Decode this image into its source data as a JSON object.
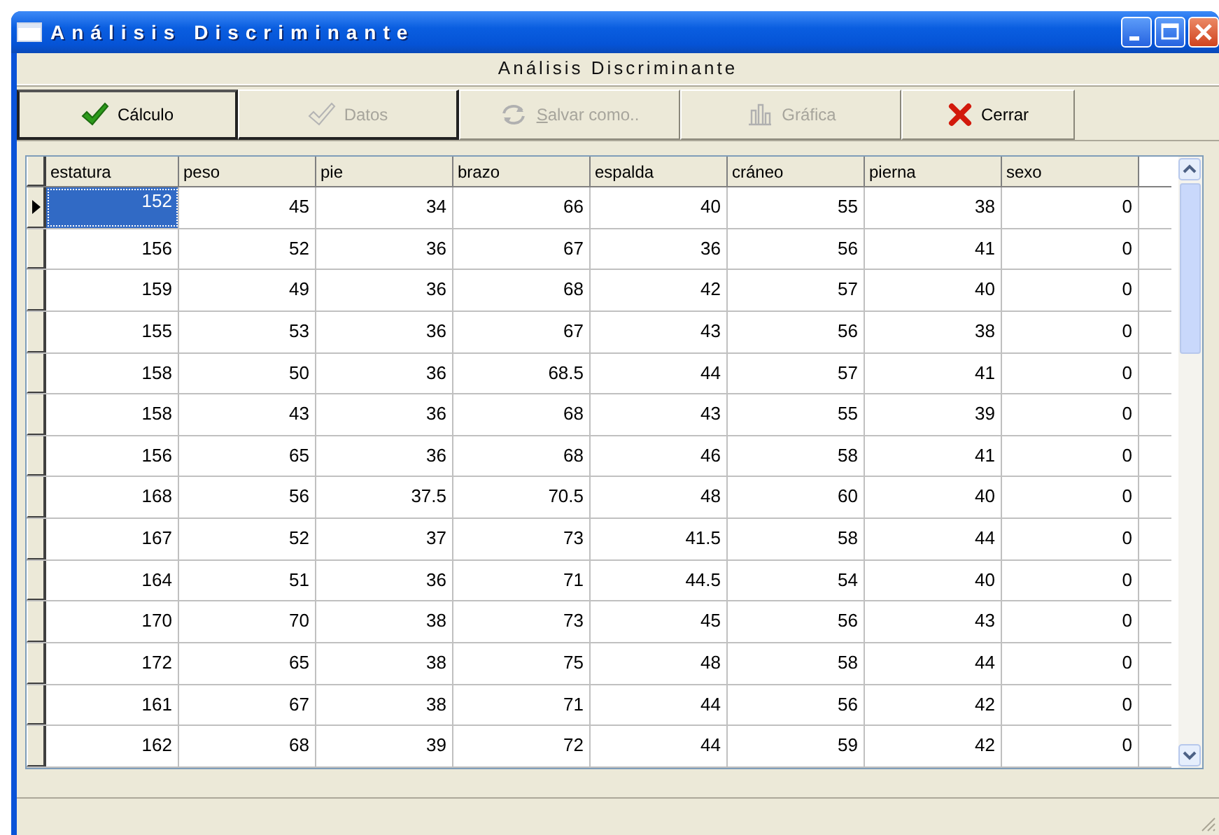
{
  "window": {
    "title": "Análisis Discriminante"
  },
  "header": "Análisis Discriminante",
  "toolbar": [
    {
      "label": "Cálculo",
      "kind": "check",
      "disabled": false,
      "underline": false
    },
    {
      "label": "Datos",
      "kind": "check",
      "disabled": true,
      "underline": false
    },
    {
      "label": "Salvar como..",
      "kind": "refresh",
      "disabled": true,
      "underline": true
    },
    {
      "label": "Gráfica",
      "kind": "chart",
      "disabled": true,
      "underline": false
    },
    {
      "label": "Cerrar",
      "kind": "cross",
      "disabled": false,
      "underline": false
    }
  ],
  "table": {
    "columns": [
      "estatura",
      "peso",
      "pie",
      "brazo",
      "espalda",
      "cráneo",
      "pierna",
      "sexo"
    ],
    "rows": [
      {
        "selected": true,
        "cells": [
          "152",
          "45",
          "34",
          "66",
          "40",
          "55",
          "38",
          "0"
        ]
      },
      {
        "selected": false,
        "cells": [
          "156",
          "52",
          "36",
          "67",
          "36",
          "56",
          "41",
          "0"
        ]
      },
      {
        "selected": false,
        "cells": [
          "159",
          "49",
          "36",
          "68",
          "42",
          "57",
          "40",
          "0"
        ]
      },
      {
        "selected": false,
        "cells": [
          "155",
          "53",
          "36",
          "67",
          "43",
          "56",
          "38",
          "0"
        ]
      },
      {
        "selected": false,
        "cells": [
          "158",
          "50",
          "36",
          "68.5",
          "44",
          "57",
          "41",
          "0"
        ]
      },
      {
        "selected": false,
        "cells": [
          "158",
          "43",
          "36",
          "68",
          "43",
          "55",
          "39",
          "0"
        ]
      },
      {
        "selected": false,
        "cells": [
          "156",
          "65",
          "36",
          "68",
          "46",
          "58",
          "41",
          "0"
        ]
      },
      {
        "selected": false,
        "cells": [
          "168",
          "56",
          "37.5",
          "70.5",
          "48",
          "60",
          "40",
          "0"
        ]
      },
      {
        "selected": false,
        "cells": [
          "167",
          "52",
          "37",
          "73",
          "41.5",
          "58",
          "44",
          "0"
        ]
      },
      {
        "selected": false,
        "cells": [
          "164",
          "51",
          "36",
          "71",
          "44.5",
          "54",
          "40",
          "0"
        ]
      },
      {
        "selected": false,
        "cells": [
          "170",
          "70",
          "38",
          "73",
          "45",
          "56",
          "43",
          "0"
        ]
      },
      {
        "selected": false,
        "cells": [
          "172",
          "65",
          "38",
          "75",
          "48",
          "58",
          "44",
          "0"
        ]
      },
      {
        "selected": false,
        "cells": [
          "161",
          "67",
          "38",
          "71",
          "44",
          "56",
          "42",
          "0"
        ]
      },
      {
        "selected": false,
        "cells": [
          "162",
          "68",
          "39",
          "72",
          "44",
          "59",
          "42",
          "0"
        ]
      }
    ]
  }
}
